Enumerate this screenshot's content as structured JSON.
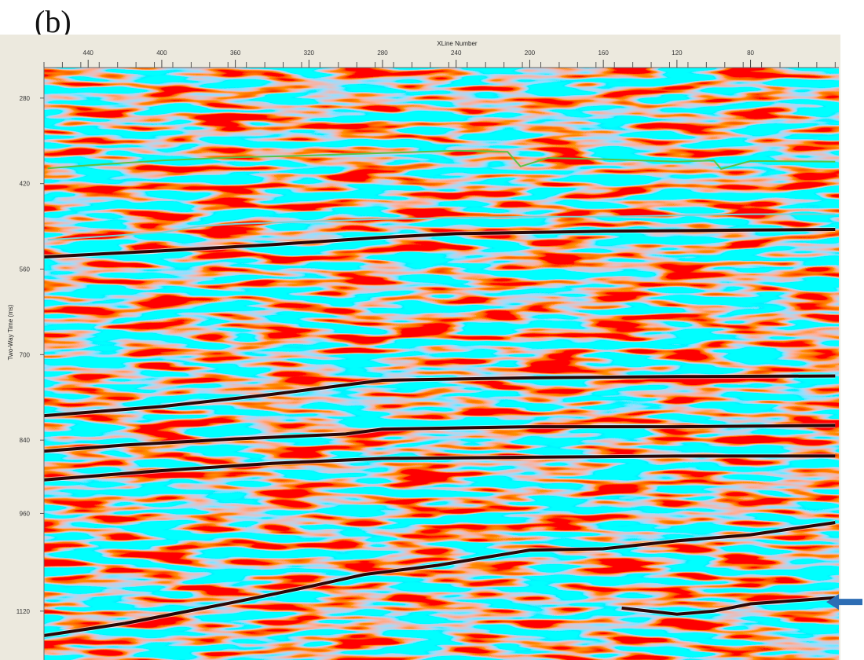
{
  "panel_label": "(b)",
  "chart_data": {
    "type": "seismic-section",
    "xlabel": "XLine Number",
    "ylabel": "Two-Way Time (ms)",
    "x_reversed": true,
    "xlim": [
      464,
      32
    ],
    "ylim": [
      230,
      1200
    ],
    "x_ticks": [
      440,
      400,
      360,
      320,
      280,
      240,
      200,
      160,
      120,
      80
    ],
    "x_tick_labels": [
      "440",
      "400",
      "360",
      "320",
      "280",
      "240",
      "200",
      "160",
      "120",
      "80"
    ],
    "y_ticks": [
      280,
      420,
      560,
      700,
      840,
      960,
      1120
    ],
    "y_tick_labels": [
      "280",
      "420",
      "560",
      "700",
      "840",
      "960",
      "1120"
    ],
    "horizons": [
      {
        "color": "#5cc246",
        "x": [
          462,
          440,
          400,
          360,
          320,
          280,
          240,
          212,
          205,
          190,
          160,
          120,
          100,
          96,
          80,
          34
        ],
        "y": [
          395,
          390,
          382,
          377,
          374,
          370,
          366,
          368,
          392,
          378,
          380,
          384,
          382,
          396,
          383,
          384
        ]
      },
      {
        "color": "#7ecfcf",
        "x": [
          462,
          440,
          400,
          380,
          360,
          320,
          280,
          240,
          200,
          160,
          120,
          80,
          34
        ],
        "y": [
          512,
          508,
          500,
          490,
          486,
          482,
          478,
          476,
          474,
          474,
          472,
          470,
          470
        ]
      }
    ],
    "reflectors": [
      {
        "color": "#2a0808",
        "x": [
          464,
          400,
          340,
          280,
          240,
          160,
          80,
          34
        ],
        "y": [
          540,
          530,
          520,
          508,
          502,
          498,
          496,
          495
        ]
      },
      {
        "color": "#2a0808",
        "x": [
          464,
          400,
          340,
          280,
          200,
          120,
          34
        ],
        "y": [
          800,
          785,
          765,
          742,
          738,
          736,
          735
        ]
      },
      {
        "color": "#2a0808",
        "x": [
          464,
          420,
          360,
          300,
          280,
          200,
          120,
          34
        ],
        "y": [
          858,
          848,
          838,
          830,
          822,
          818,
          818,
          816
        ]
      },
      {
        "color": "#2a0808",
        "x": [
          464,
          400,
          340,
          280,
          200,
          120,
          34
        ],
        "y": [
          905,
          890,
          878,
          870,
          868,
          866,
          866
        ]
      },
      {
        "color": "#2a0808",
        "x": [
          464,
          420,
          360,
          320,
          290,
          250,
          200,
          160,
          120,
          80,
          34
        ],
        "y": [
          1160,
          1140,
          1105,
          1080,
          1060,
          1045,
          1020,
          1018,
          1005,
          995,
          975
        ]
      },
      {
        "color": "#2a0808",
        "x": [
          150,
          120,
          100,
          80,
          34
        ],
        "y": [
          1115,
          1125,
          1120,
          1108,
          1098
        ]
      }
    ],
    "annotations": [
      {
        "type": "arrow",
        "pointing": "left",
        "y": 1105,
        "color": "#2d6db4"
      }
    ]
  }
}
